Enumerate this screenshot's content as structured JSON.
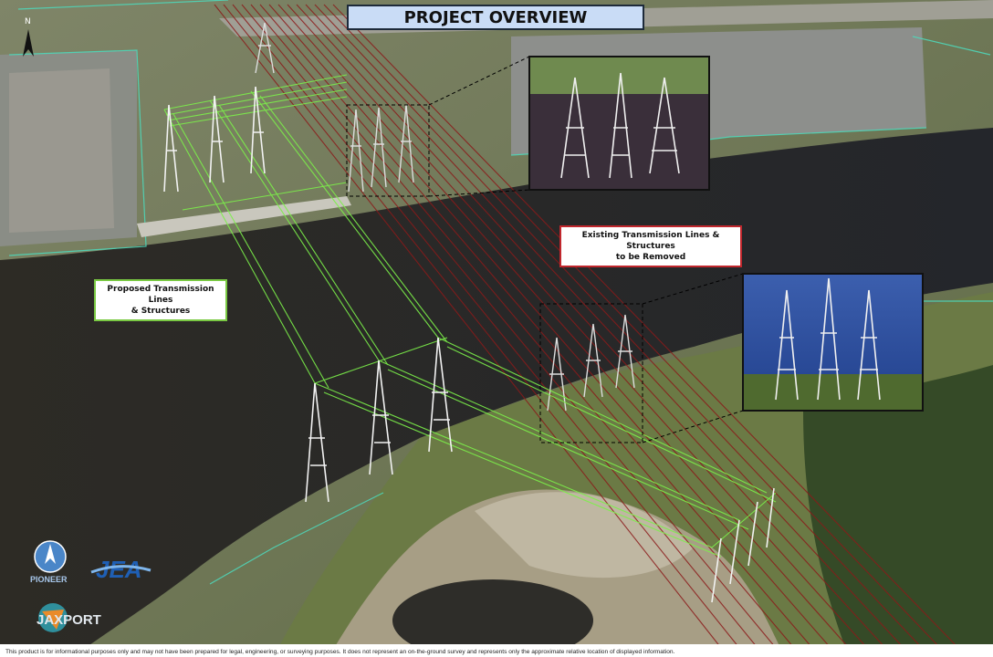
{
  "map": {
    "title": "PROJECT OVERVIEW",
    "callouts": {
      "existing": {
        "line1": "Existing Transmission Lines & Structures",
        "line2": "to be Removed"
      },
      "proposed": {
        "line1": "Proposed Transmission Lines",
        "line2": "& Structures"
      }
    },
    "north_arrow_label": "N",
    "colors": {
      "existing_lines": "#8b1a1a",
      "proposed_lines": "#7cf04a",
      "title_fill": "#c9dcf6",
      "water": "#2b2a25",
      "parcel_outline": "#4fd6b8"
    },
    "disclaimer": "This product is for informational purposes only and may not have been prepared for legal, engineering, or surveying purposes. It does not represent an on-the-ground survey and represents only the approximate relative location of displayed information."
  },
  "logos": {
    "pioneer": "PIONEER",
    "jea": "JEA",
    "jaxport": "JAXPORT"
  }
}
